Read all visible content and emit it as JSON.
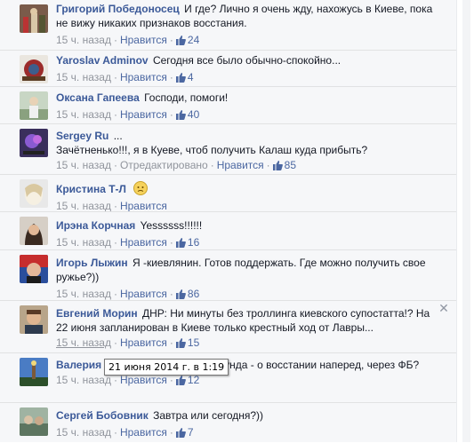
{
  "comments": [
    {
      "author": "Григорий Победоносец",
      "text": "И где? Лично я очень жду, нахожусь в Киеве, пока не вижу никаких признаков восстания.",
      "time": "15 ч. назад",
      "like_label": "Нравится",
      "likes": "24",
      "edited": null
    },
    {
      "author": "Yaroslav Adminov",
      "text": "Сегодня все было обычно-спокойно...",
      "time": "15 ч. назад",
      "like_label": "Нравится",
      "likes": "4",
      "edited": null
    },
    {
      "author": "Оксана Гапеева",
      "text": "Господи, помоги!",
      "time": "15 ч. назад",
      "like_label": "Нравится",
      "likes": "40",
      "edited": null
    },
    {
      "author": "Sergey Ru",
      "text": "Зачётненько!!!, я в Куеве, чтоб получить Калаш куда прибыть?",
      "time": "15 ч. назад",
      "like_label": "Нравится",
      "likes": "85",
      "edited": "Отредактировано"
    },
    {
      "author": "Кристина Т-Л",
      "text": "",
      "time": "15 ч. назад",
      "like_label": "Нравится",
      "likes": null,
      "edited": null
    },
    {
      "author": "Ирэна Корчная",
      "text": "Yessssss!!!!!!",
      "time": "15 ч. назад",
      "like_label": "Нравится",
      "likes": "16",
      "edited": null
    },
    {
      "author": "Игорь Лыжин",
      "text": "Я -киевлянин. Готов поддержать. Где можно получить свое ружье?))",
      "time": "15 ч. назад",
      "like_label": "Нравится",
      "likes": "86",
      "edited": null
    },
    {
      "author": "Евгений Морин",
      "text": "ДНР: Ни минуты без троллинга киевского супостатта!? На 22 июня запланирован в Киеве только крестный ход от Лавры...",
      "time": "15 ч. назад",
      "like_label": "Нравится",
      "likes": "15",
      "edited": null
    },
    {
      "author": "Валерия",
      "text": "то ерунда - о восстании наперед, через ФБ?",
      "time": "15 ч. назад",
      "like_label": "Нравится",
      "likes": "12",
      "edited": null
    },
    {
      "author": "Сергей Бобовник",
      "text": "Завтра или сегодня?))",
      "time": "15 ч. назад",
      "like_label": "Нравится",
      "likes": "7",
      "edited": null
    }
  ],
  "tooltip": "21 июня 2014 г. в 1:19",
  "colors": {
    "link": "#3b5998",
    "meta": "#90949c",
    "background": "#f6f7f9"
  }
}
